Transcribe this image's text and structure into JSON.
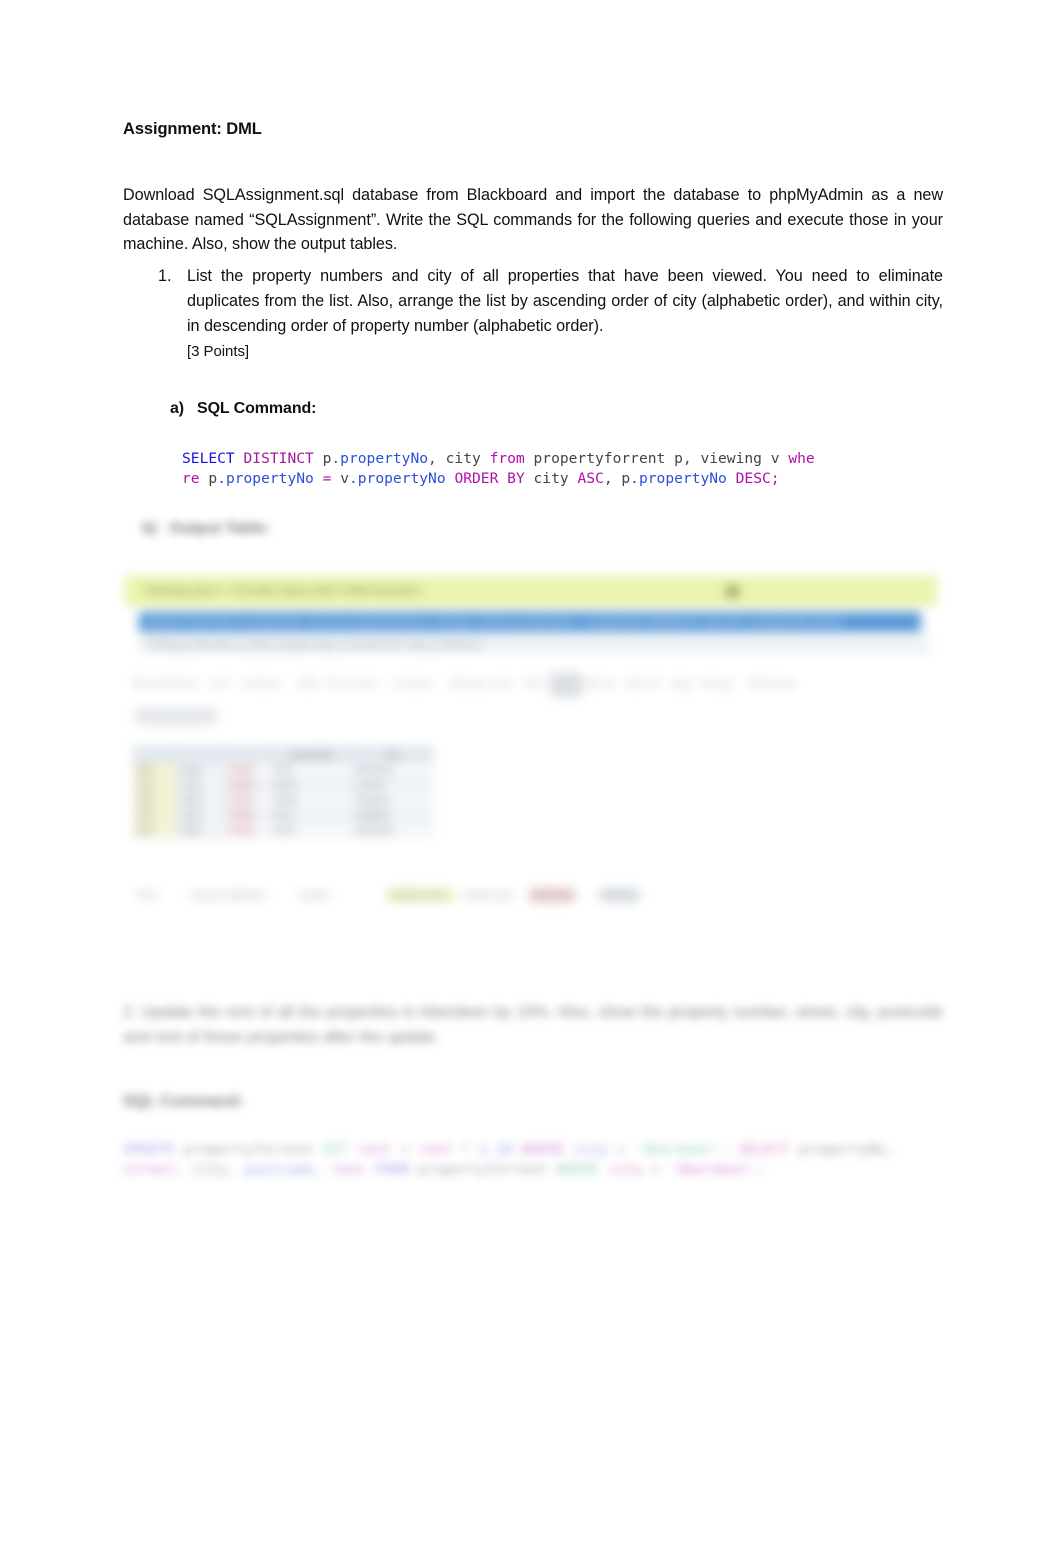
{
  "document": {
    "title": "Assignment: DML",
    "intro": "Download SQLAssignment.sql database from Blackboard and import the database to phpMyAdmin as a new database named “SQLAssignment”. Write the SQL commands for the following queries and execute those in your machine.  Also, show the output tables."
  },
  "question1": {
    "number": "1.",
    "text": "List the property numbers and city of all properties that have been viewed. You need to eliminate duplicates from the list. Also, arrange the list by ascending order of city (alphabetic order), and within city, in descending order of property number (alphabetic order).",
    "points": "[3 Points]",
    "part_a": {
      "letter": "a)",
      "label": "SQL Command:",
      "sql_tokens": [
        {
          "t": "SELECT",
          "c": "kw-blue"
        },
        {
          "t": " ",
          "c": "id-plain"
        },
        {
          "t": "DISTINCT",
          "c": "kw-purple"
        },
        {
          "t": " p",
          "c": "id-plain"
        },
        {
          "t": ".propertyNo",
          "c": "id-blue"
        },
        {
          "t": ", city ",
          "c": "id-plain"
        },
        {
          "t": "from",
          "c": "kw-magenta"
        },
        {
          "t": " propertyforrent p, viewing v ",
          "c": "id-plain"
        },
        {
          "t": "whe\nre",
          "c": "kw-magenta"
        },
        {
          "t": " p",
          "c": "id-plain"
        },
        {
          "t": ".propertyNo",
          "c": "id-blue"
        },
        {
          "t": " ",
          "c": "id-plain"
        },
        {
          "t": "=",
          "c": "kw-magenta"
        },
        {
          "t": " v",
          "c": "id-plain"
        },
        {
          "t": ".propertyNo",
          "c": "id-blue"
        },
        {
          "t": " ",
          "c": "id-plain"
        },
        {
          "t": "ORDER BY",
          "c": "kw-magenta"
        },
        {
          "t": " city ",
          "c": "id-plain"
        },
        {
          "t": "ASC",
          "c": "kw-magenta"
        },
        {
          "t": ", p",
          "c": "id-plain"
        },
        {
          "t": ".propertyNo",
          "c": "id-blue"
        },
        {
          "t": " ",
          "c": "id-plain"
        },
        {
          "t": "DESC",
          "c": "kw-magenta"
        },
        {
          "t": ";",
          "c": "kw-magenta"
        }
      ],
      "sql_plain": "SELECT DISTINCT p.propertyNo, city from propertyforrent p, viewing v where p.propertyNo = v.propertyNo ORDER BY city ASC, p.propertyNo DESC;"
    },
    "part_b": {
      "letter": "b)",
      "label": "Output Table:"
    }
  },
  "screenshot": {
    "app": "phpMyAdmin",
    "success_message": "Showing rows 0 - 8 (9 total, Query took 0.0009 seconds.)",
    "success_icon": "info-circle-icon",
    "sql_bar": "SELECT DISTINCT p.propertyNo, city from propertyforrent p, viewing v where p.propertyNo = v.propertyNo ORDER BY city ASC, p.propertyNo DESC;",
    "profile_line": "Profiling [ Edit inline ] [ Edit ] [ Explain SQL ] [ Create PHP code ] [ Refresh ]",
    "toolbar": "Number of rows: 25   Filter rows: Search this table   Sort by key: None",
    "subtoolbar": "Options",
    "columns": [
      "",
      "",
      "",
      "propertyNo",
      "city"
    ],
    "rows": [
      {
        "edit": "Edit",
        "copy": "Copy",
        "delete": "Delete",
        "propertyNo": "PG4",
        "city": "Aberdeen"
      },
      {
        "edit": "Edit",
        "copy": "Copy",
        "delete": "Delete",
        "propertyNo": "PL94",
        "city": "London"
      },
      {
        "edit": "Edit",
        "copy": "Copy",
        "delete": "Delete",
        "propertyNo": "PG36",
        "city": "Glasgow"
      },
      {
        "edit": "Edit",
        "copy": "Copy",
        "delete": "Delete",
        "propertyNo": "PG4",
        "city": "Glasgow"
      },
      {
        "edit": "Edit",
        "copy": "Copy",
        "delete": "Delete",
        "propertyNo": "PA14",
        "city": "Aberdeen"
      }
    ],
    "action_bar": [
      "Print",
      "Copy to clipboard",
      "Export",
      "Display chart",
      "Create view",
      "Bookmark",
      "Refresh"
    ],
    "colors": {
      "success_bg": "#e9f4a6",
      "sql_bar_bg": "#4a8fd4",
      "grid_header_bg": "#dfe7ee",
      "delete_text": "#d04a4a",
      "edit_cell_bg": "#f5f2cf"
    }
  },
  "question2": {
    "text": "2. Update the rent of all the properties in Aberdeen by 10%. Also, show the property number, street, city, postcode and rent of those properties after the update.",
    "part_label": "SQL Command:",
    "sql_plain": "UPDATE propertyforrent SET rent = rent * 1.10 WHERE city = 'Aberdeen'; SELECT propertyNo, street, city, postcode, rent FROM propertyforrent WHERE city = 'Aberdeen';"
  }
}
